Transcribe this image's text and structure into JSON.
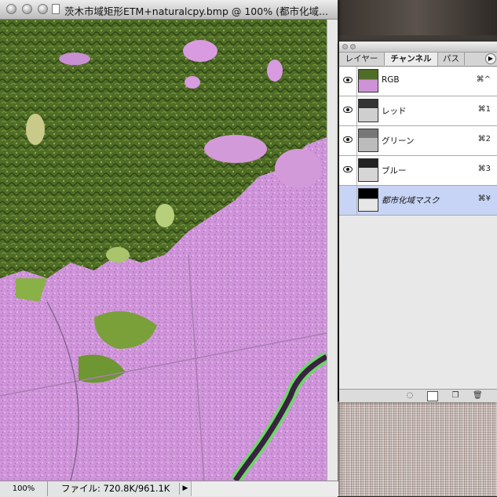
{
  "document": {
    "title": "茨木市域矩形ETM+naturalcpy.bmp @ 100% (都市化域...",
    "zoom": "100%",
    "file_info": "ファイル: 720.8K/961.1K"
  },
  "palette": {
    "tabs": [
      {
        "label": "レイヤー",
        "active": false
      },
      {
        "label": "チャンネル",
        "active": true
      },
      {
        "label": "パス",
        "active": false
      }
    ],
    "channels": [
      {
        "name": "RGB",
        "shortcut": "⌘^",
        "visible": true,
        "selected": false
      },
      {
        "name": "レッド",
        "shortcut": "⌘1",
        "visible": true,
        "selected": false
      },
      {
        "name": "グリーン",
        "shortcut": "⌘2",
        "visible": true,
        "selected": false
      },
      {
        "name": "ブルー",
        "shortcut": "⌘3",
        "visible": true,
        "selected": false
      },
      {
        "name": "都市化域マスク",
        "shortcut": "⌘¥",
        "visible": false,
        "selected": true
      }
    ],
    "menu_icon": "triangle-right-icon",
    "bottom_buttons": [
      "load-selection-icon",
      "save-selection-icon",
      "new-channel-icon",
      "trash-icon"
    ]
  },
  "colors": {
    "urban_mask": "#cf92d8",
    "forest": "#4e6b26",
    "selection": "#c7d4f5"
  }
}
